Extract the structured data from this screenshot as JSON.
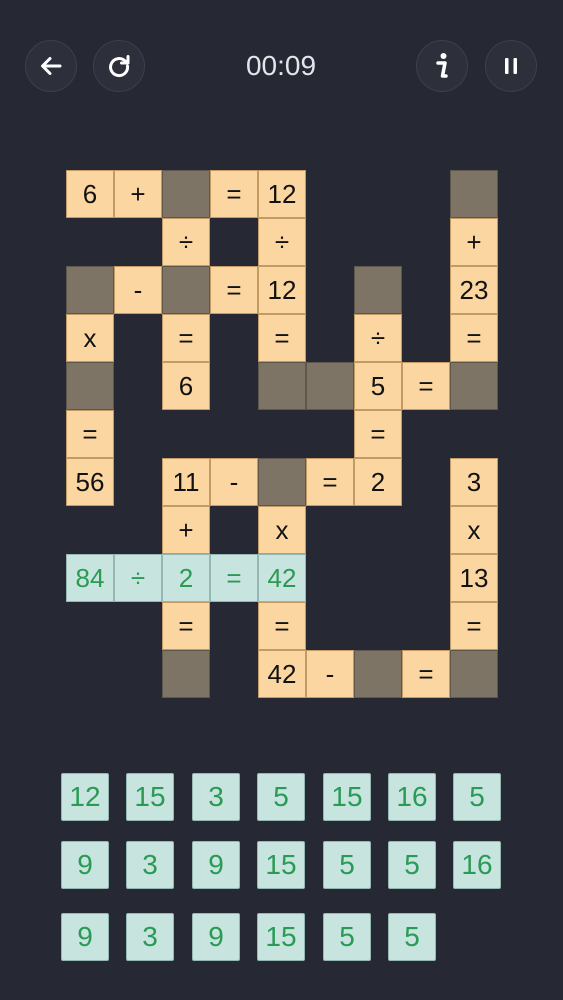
{
  "header": {
    "timer": "00:09",
    "buttons": {
      "back": "arrow-left-icon",
      "restart": "restart-icon",
      "info": "info-icon",
      "pause": "pause-icon"
    }
  },
  "colors": {
    "background": "#262833",
    "given_cell": "#fcd6a0",
    "blank_cell": "#7d7466",
    "solved_cell": "#c7e4df",
    "solved_text": "#2a9a55"
  },
  "board": {
    "rows": [
      [
        {
          "c": 0,
          "t": "6"
        },
        {
          "c": 1,
          "t": "+"
        },
        {
          "c": 2,
          "k": "blank"
        },
        {
          "c": 3,
          "t": "="
        },
        {
          "c": 4,
          "t": "12"
        },
        {
          "c": 8,
          "k": "blank"
        }
      ],
      [
        {
          "c": 2,
          "t": "÷"
        },
        {
          "c": 4,
          "t": "÷"
        },
        {
          "c": 8,
          "t": "+"
        }
      ],
      [
        {
          "c": 0,
          "k": "blank"
        },
        {
          "c": 1,
          "t": "-"
        },
        {
          "c": 2,
          "k": "blank"
        },
        {
          "c": 3,
          "t": "="
        },
        {
          "c": 4,
          "t": "12"
        },
        {
          "c": 6,
          "k": "blank"
        },
        {
          "c": 8,
          "t": "23"
        }
      ],
      [
        {
          "c": 0,
          "t": "x"
        },
        {
          "c": 2,
          "t": "="
        },
        {
          "c": 4,
          "t": "="
        },
        {
          "c": 6,
          "t": "÷"
        },
        {
          "c": 8,
          "t": "="
        }
      ],
      [
        {
          "c": 0,
          "k": "blank"
        },
        {
          "c": 2,
          "t": "6"
        },
        {
          "c": 4,
          "k": "blank"
        },
        {
          "c": 5,
          "k": "blank"
        },
        {
          "c": 6,
          "t": "5"
        },
        {
          "c": 7,
          "t": "="
        },
        {
          "c": 8,
          "k": "blank"
        }
      ],
      [
        {
          "c": 0,
          "t": "="
        },
        {
          "c": 6,
          "t": "="
        }
      ],
      [
        {
          "c": 0,
          "t": "56"
        },
        {
          "c": 2,
          "t": "11"
        },
        {
          "c": 3,
          "t": "-"
        },
        {
          "c": 4,
          "k": "blank"
        },
        {
          "c": 5,
          "t": "="
        },
        {
          "c": 6,
          "t": "2"
        },
        {
          "c": 8,
          "t": "3"
        }
      ],
      [
        {
          "c": 2,
          "t": "+"
        },
        {
          "c": 4,
          "t": "x"
        },
        {
          "c": 8,
          "t": "x"
        }
      ],
      [
        {
          "c": 0,
          "t": "84",
          "k": "solved"
        },
        {
          "c": 1,
          "t": "÷",
          "k": "solved"
        },
        {
          "c": 2,
          "t": "2",
          "k": "solved"
        },
        {
          "c": 3,
          "t": "=",
          "k": "solved"
        },
        {
          "c": 4,
          "t": "42",
          "k": "solved"
        },
        {
          "c": 8,
          "t": "13"
        }
      ],
      [
        {
          "c": 2,
          "t": "="
        },
        {
          "c": 4,
          "t": "="
        },
        {
          "c": 8,
          "t": "="
        }
      ],
      [
        {
          "c": 2,
          "k": "blank"
        },
        {
          "c": 4,
          "t": "42"
        },
        {
          "c": 5,
          "t": "-"
        },
        {
          "c": 6,
          "k": "blank"
        },
        {
          "c": 7,
          "t": "="
        },
        {
          "c": 8,
          "k": "blank"
        }
      ]
    ]
  },
  "tray": {
    "rows": [
      [
        "12",
        "15",
        "3",
        "5",
        "15",
        "16",
        "5"
      ],
      [
        "9",
        "3",
        "9",
        "15",
        "5",
        "5",
        "16"
      ],
      [
        "9",
        "3",
        "9",
        "15",
        "5",
        "5"
      ]
    ]
  }
}
